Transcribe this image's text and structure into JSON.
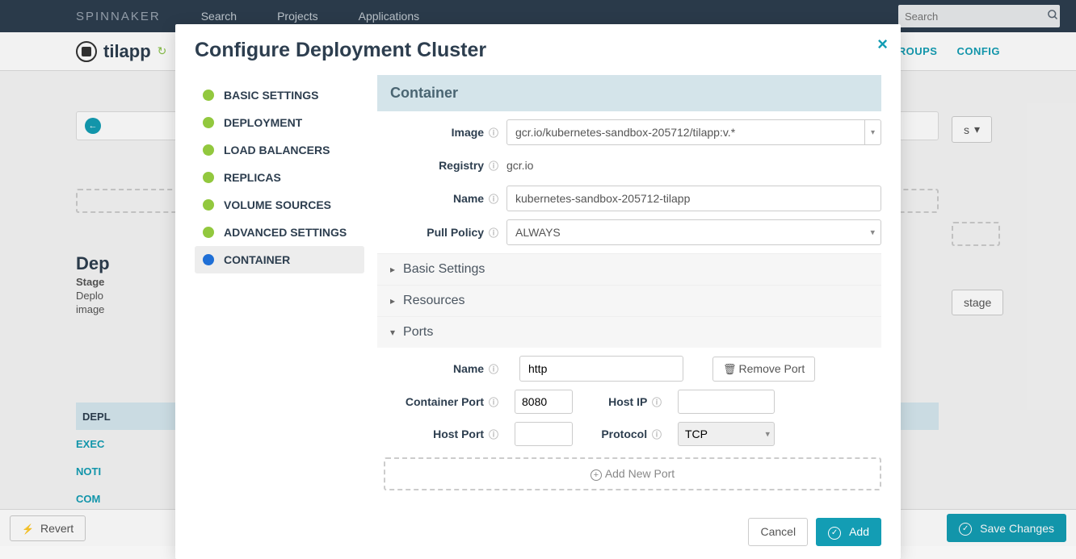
{
  "topnav": {
    "brand": "SPINNAKER",
    "links": [
      "Search",
      "Projects",
      "Applications"
    ],
    "search_placeholder": "Search"
  },
  "subnav": {
    "app_name": "tilapp",
    "right_links": [
      "TY GROUPS",
      "CONFIG"
    ]
  },
  "background": {
    "heading": "Dep",
    "stage_label": "Stage",
    "desc1": "Deplo",
    "desc2": "image",
    "tabs": [
      "DEPL",
      "EXEC",
      "NOTI",
      "COM"
    ],
    "stage_btn": "stage",
    "dropdown_hint": "s"
  },
  "footer": {
    "revert": "Revert",
    "save": "Save Changes"
  },
  "modal": {
    "title": "Configure Deployment Cluster",
    "nav": [
      "BASIC SETTINGS",
      "DEPLOYMENT",
      "LOAD BALANCERS",
      "REPLICAS",
      "VOLUME SOURCES",
      "ADVANCED SETTINGS",
      "CONTAINER"
    ],
    "active_nav_index": 6,
    "section_title": "Container",
    "fields": {
      "image_label": "Image",
      "image_value": "gcr.io/kubernetes-sandbox-205712/tilapp:v.*",
      "registry_label": "Registry",
      "registry_value": "gcr.io",
      "name_label": "Name",
      "name_value": "kubernetes-sandbox-205712-tilapp",
      "pull_policy_label": "Pull Policy",
      "pull_policy_value": "ALWAYS"
    },
    "subsections": {
      "basic": "Basic Settings",
      "resources": "Resources",
      "ports": "Ports"
    },
    "ports": {
      "name_label": "Name",
      "name_value": "http",
      "remove_label": "Remove Port",
      "container_port_label": "Container Port",
      "container_port_value": "8080",
      "host_ip_label": "Host IP",
      "host_ip_value": "",
      "host_port_label": "Host Port",
      "host_port_value": "",
      "protocol_label": "Protocol",
      "protocol_value": "TCP",
      "add_label": "Add New Port"
    },
    "footer": {
      "cancel": "Cancel",
      "add": "Add"
    }
  }
}
